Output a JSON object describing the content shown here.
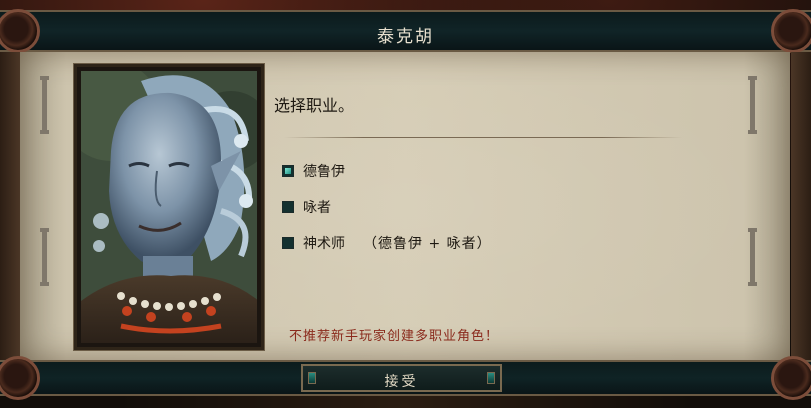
{
  "dialog": {
    "title": "泰克胡",
    "prompt": "选择职业。",
    "options": [
      {
        "label": "德鲁伊",
        "checked": true
      },
      {
        "label": "咏者",
        "checked": false
      },
      {
        "label": "神术师",
        "detail": "（德鲁伊 + 咏者）",
        "checked": false
      }
    ],
    "warning": "不推荐新手玩家创建多职业角色！",
    "accept_label": "接受"
  },
  "colors": {
    "parchment": "#d6cdb6",
    "header_bg": "#102427",
    "warning_text": "#8a2a1c",
    "checkbox_checked": "#5fd3c0"
  },
  "icons": {
    "portrait": "character-portrait-orlan-druid",
    "curl": "scroll-curl-ornament",
    "gem": "button-gem-ornament"
  }
}
